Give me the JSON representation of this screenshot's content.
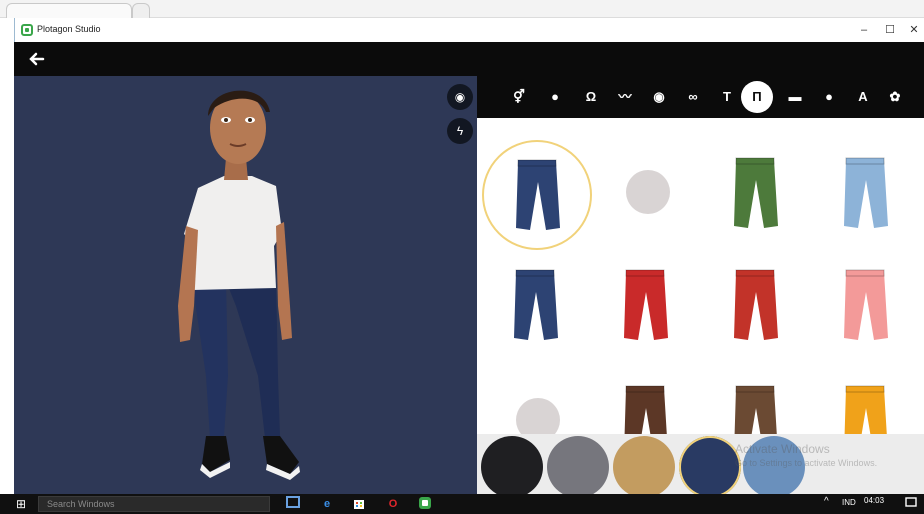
{
  "window": {
    "title": "Plotagon Studio",
    "minimize": "–",
    "maximize": "☐",
    "close": "✕"
  },
  "header": {
    "back_glyph": "🡐"
  },
  "viewport": {
    "camera_glyph": "◉",
    "bolt_glyph": "ϟ"
  },
  "categories": [
    {
      "name": "gender-icon",
      "glyph": "⚥"
    },
    {
      "name": "head-icon",
      "glyph": "●"
    },
    {
      "name": "hair-icon",
      "glyph": "Ω"
    },
    {
      "name": "mustache-icon",
      "glyph": "〰"
    },
    {
      "name": "eye-icon",
      "glyph": "◉"
    },
    {
      "name": "glasses-icon",
      "glyph": "∞"
    },
    {
      "name": "shirt-icon",
      "glyph": "T"
    },
    {
      "name": "pants-icon",
      "glyph": "Π"
    },
    {
      "name": "shoes-icon",
      "glyph": "▬"
    },
    {
      "name": "speech-icon",
      "glyph": "●"
    },
    {
      "name": "text-icon",
      "glyph": "A"
    },
    {
      "name": "palette-icon",
      "glyph": "✿"
    }
  ],
  "colors": {
    "viewport_bg": "#2e3856",
    "header_bg": "#0b0b0b",
    "selection_ring": "#f1d27a"
  },
  "items": [
    {
      "name": "pants-dark-navy-top",
      "color": "#1c1c1c",
      "col": 0,
      "row": -1
    },
    {
      "name": "pants-black-top",
      "color": "#1c1c1c",
      "col": 1,
      "row": -1
    },
    {
      "name": "pants-white-top",
      "color": "#e8e6e2",
      "col": 2,
      "row": -1
    },
    {
      "name": "pants-white-top-2",
      "color": "#e8e6e2",
      "col": 3,
      "row": -1
    },
    {
      "name": "pants-navy",
      "color": "#2d4373",
      "col": 0,
      "row": 0,
      "selected": true
    },
    {
      "name": "no-pants",
      "color": "",
      "col": 1,
      "row": 0
    },
    {
      "name": "pants-green",
      "color": "#4d7a3b",
      "col": 2,
      "row": 0
    },
    {
      "name": "pants-lightblue",
      "color": "#8db3d8",
      "col": 3,
      "row": 0
    },
    {
      "name": "pants-navy-cuffed",
      "color": "#2d4373",
      "col": 0,
      "row": 1
    },
    {
      "name": "pants-red-chain",
      "color": "#c92a2a",
      "col": 1,
      "row": 1
    },
    {
      "name": "pants-red",
      "color": "#c23329",
      "col": 2,
      "row": 1
    },
    {
      "name": "pants-pink",
      "color": "#f39a99",
      "col": 3,
      "row": 1
    },
    {
      "name": "no-pants-2",
      "color": "",
      "col": 0,
      "row": 2
    },
    {
      "name": "pants-brown",
      "color": "#5c3726",
      "col": 1,
      "row": 2
    },
    {
      "name": "pants-brown-2",
      "color": "#6b4a33",
      "col": 2,
      "row": 2
    },
    {
      "name": "pants-yellow-camo",
      "color": "#f0a21a",
      "col": 3,
      "row": 2
    }
  ],
  "swatches": [
    {
      "color": "#1f1f22"
    },
    {
      "color": "#76767d"
    },
    {
      "color": "#c39c60"
    },
    {
      "color": "#293a63",
      "selected": true
    },
    {
      "color": "#6a90bc"
    }
  ],
  "watermark": {
    "line1": "Activate Windows",
    "line2": "Go to Settings to activate Windows."
  },
  "taskbar": {
    "start_glyph": "⊞",
    "search_placeholder": "Search Windows",
    "lang": "IND",
    "time": "04:03",
    "caret": "^"
  }
}
